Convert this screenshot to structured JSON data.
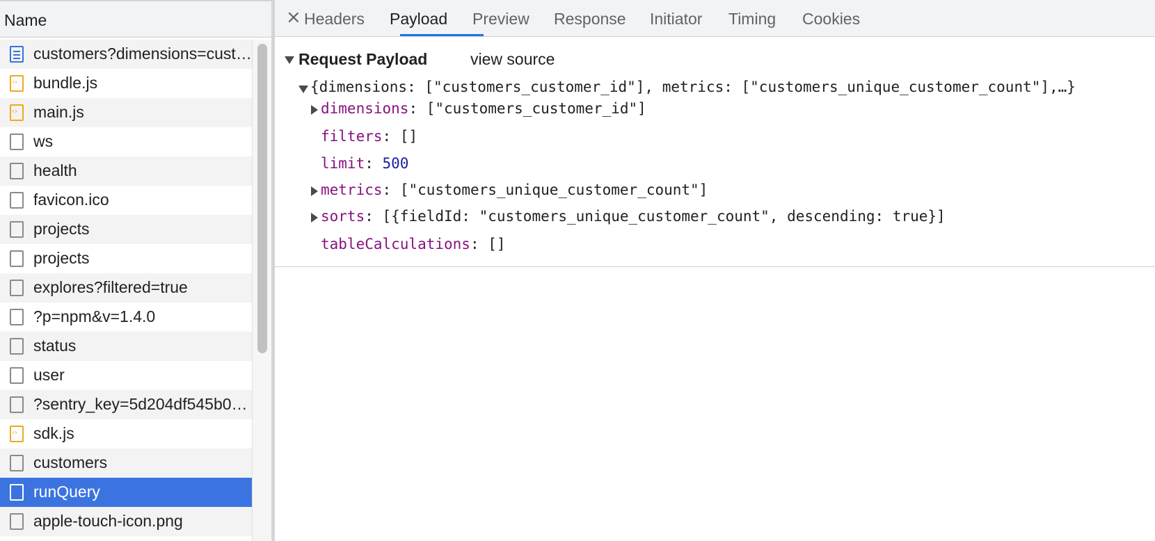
{
  "request_list": {
    "header": "Name",
    "rows": [
      {
        "name": "customers?dimensions=cust…",
        "icon": "document-icon"
      },
      {
        "name": "bundle.js",
        "icon": "script-icon"
      },
      {
        "name": "main.js",
        "icon": "script-icon"
      },
      {
        "name": "ws",
        "icon": "file-icon"
      },
      {
        "name": "health",
        "icon": "file-icon"
      },
      {
        "name": "favicon.ico",
        "icon": "file-icon"
      },
      {
        "name": "projects",
        "icon": "file-icon"
      },
      {
        "name": "projects",
        "icon": "file-icon"
      },
      {
        "name": "explores?filtered=true",
        "icon": "file-icon"
      },
      {
        "name": "?p=npm&v=1.4.0",
        "icon": "file-icon"
      },
      {
        "name": "status",
        "icon": "file-icon"
      },
      {
        "name": "user",
        "icon": "file-icon"
      },
      {
        "name": "?sentry_key=5d204df545b0…",
        "icon": "file-icon"
      },
      {
        "name": "sdk.js",
        "icon": "script-icon"
      },
      {
        "name": "customers",
        "icon": "file-icon"
      },
      {
        "name": "runQuery",
        "icon": "file-icon",
        "selected": true
      },
      {
        "name": "apple-touch-icon.png",
        "icon": "file-icon"
      }
    ]
  },
  "tabs": {
    "close": "×",
    "items": [
      "Headers",
      "Payload",
      "Preview",
      "Response",
      "Initiator",
      "Timing",
      "Cookies"
    ],
    "active": "Payload"
  },
  "payload": {
    "section_title": "Request Payload",
    "view_source": "view source",
    "root_summary": "{dimensions: [\"customers_customer_id\"], metrics: [\"customers_unique_customer_count\"],…}",
    "properties": [
      {
        "key": "dimensions",
        "value": "[\"customers_customer_id\"]",
        "expandable": true
      },
      {
        "key": "filters",
        "value": "[]",
        "expandable": false
      },
      {
        "key": "limit",
        "value": "500",
        "expandable": false,
        "numeric": true
      },
      {
        "key": "metrics",
        "value": "[\"customers_unique_customer_count\"]",
        "expandable": true
      },
      {
        "key": "sorts",
        "value": "[{fieldId: \"customers_unique_customer_count\", descending: true}]",
        "expandable": true
      },
      {
        "key": "tableCalculations",
        "value": "[]",
        "expandable": false
      }
    ]
  },
  "colors": {
    "selected_row": "#3b74e0",
    "active_tab_underline": "#1a73e8",
    "key": "#881280",
    "number": "#1a1aa6"
  }
}
